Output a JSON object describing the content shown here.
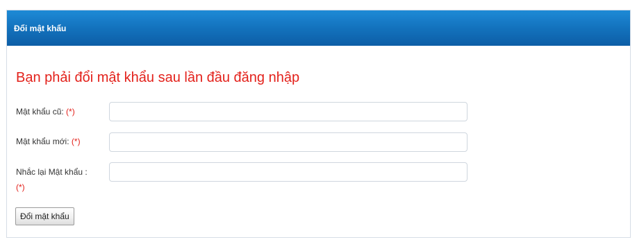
{
  "header": {
    "title": "Đổi mật khẩu"
  },
  "notice": "Bạn phải đổi mật khẩu sau lần đầu đăng nhập",
  "required_mark": "(*)",
  "fields": {
    "old_password": {
      "label": "Mật khẩu cũ:",
      "value": ""
    },
    "new_password": {
      "label": "Mật khẩu mới:",
      "value": ""
    },
    "confirm_password": {
      "label": "Nhắc lại Mật khẩu :",
      "value": ""
    }
  },
  "submit_label": "Đổi mật khẩu",
  "colors": {
    "header_bg": "#1372bd",
    "header_text": "#ffffff",
    "notice": "#e3211b",
    "required": "#e3211b"
  }
}
